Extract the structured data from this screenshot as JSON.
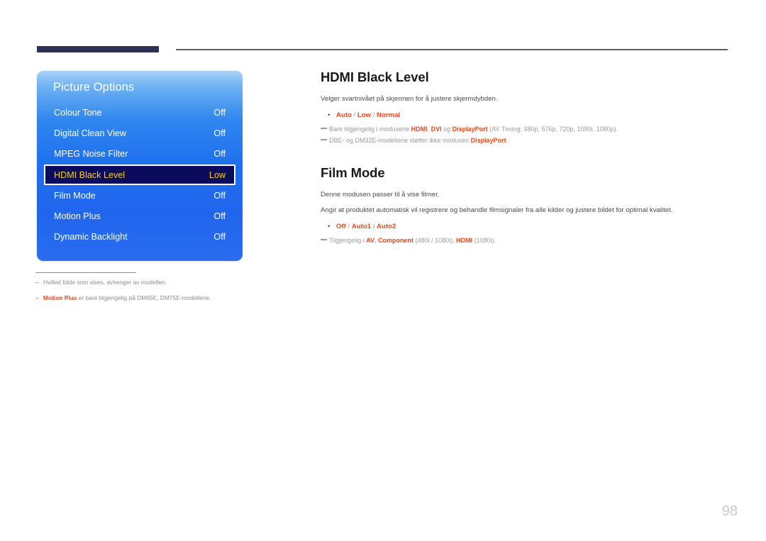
{
  "page": {
    "number": "98"
  },
  "osd": {
    "title": "Picture Options",
    "rows": [
      {
        "label": "Colour Tone",
        "value": "Off",
        "selected": false
      },
      {
        "label": "Digital Clean View",
        "value": "Off",
        "selected": false
      },
      {
        "label": "MPEG Noise Filter",
        "value": "Off",
        "selected": false
      },
      {
        "label": "HDMI Black Level",
        "value": "Low",
        "selected": true
      },
      {
        "label": "Film Mode",
        "value": "Off",
        "selected": false
      },
      {
        "label": "Motion Plus",
        "value": "Off",
        "selected": false
      },
      {
        "label": "Dynamic Backlight",
        "value": "Off",
        "selected": false
      }
    ],
    "colors": {
      "panel_blue": "#1f6fee",
      "selected_bg": "#0a0b5c",
      "selected_text": "#ffd200"
    }
  },
  "left_footnotes": [
    {
      "dash": "–",
      "pre": "",
      "strong": "",
      "post": "Hvilket bilde som vises, avhenger av modellen."
    },
    {
      "dash": "–",
      "pre": "",
      "strong": "Motion Plus",
      "post": " er bare tilgjengelig på DM65E, DM75E-modellene."
    }
  ],
  "sections": [
    {
      "title": "HDMI Black Level",
      "paragraphs": [
        "Velger svartnivået på skjermen for å justere skjermdybden."
      ],
      "options": {
        "bullet": "•",
        "items": [
          {
            "text": "Auto",
            "strong": true
          },
          {
            "text": " / ",
            "strong": false
          },
          {
            "text": "Low",
            "strong": true
          },
          {
            "text": " / ",
            "strong": false
          },
          {
            "text": "Normal",
            "strong": true
          }
        ]
      },
      "notes": [
        {
          "parts": [
            {
              "text": "Bare tilgjengelig i modusene ",
              "strong": false
            },
            {
              "text": "HDMI",
              "strong": true
            },
            {
              "text": ", ",
              "strong": false
            },
            {
              "text": "DVI",
              "strong": true
            },
            {
              "text": " og ",
              "strong": false
            },
            {
              "text": "DisplayPort",
              "strong": true
            },
            {
              "text": " (AV Timing: 480p, 576p, 720p, 1080i, 1080p).",
              "strong": false
            }
          ]
        },
        {
          "parts": [
            {
              "text": "DBE- og DM32E-modellene støtter ikke modusen ",
              "strong": false
            },
            {
              "text": "DisplayPort",
              "strong": true
            },
            {
              "text": ".",
              "strong": false
            }
          ]
        }
      ]
    },
    {
      "title": "Film Mode",
      "paragraphs": [
        "Denne modusen passer til å vise filmer.",
        "Angir at produktet automatisk vil registrere og behandle filmsignaler fra alle kilder og justere bildet for optimal kvalitet."
      ],
      "options": {
        "bullet": "•",
        "items": [
          {
            "text": "Off",
            "strong": true
          },
          {
            "text": " / ",
            "strong": false
          },
          {
            "text": "Auto1",
            "strong": true
          },
          {
            "text": " / ",
            "strong": false
          },
          {
            "text": "Auto2",
            "strong": true
          }
        ]
      },
      "notes": [
        {
          "parts": [
            {
              "text": "Tilgjengelig i ",
              "strong": false
            },
            {
              "text": "AV",
              "strong": true
            },
            {
              "text": ", ",
              "strong": false
            },
            {
              "text": "Component",
              "strong": true
            },
            {
              "text": " (480i / 1080i), ",
              "strong": false
            },
            {
              "text": "HDMI",
              "strong": true
            },
            {
              "text": " (1080i).",
              "strong": false
            }
          ]
        }
      ]
    }
  ]
}
